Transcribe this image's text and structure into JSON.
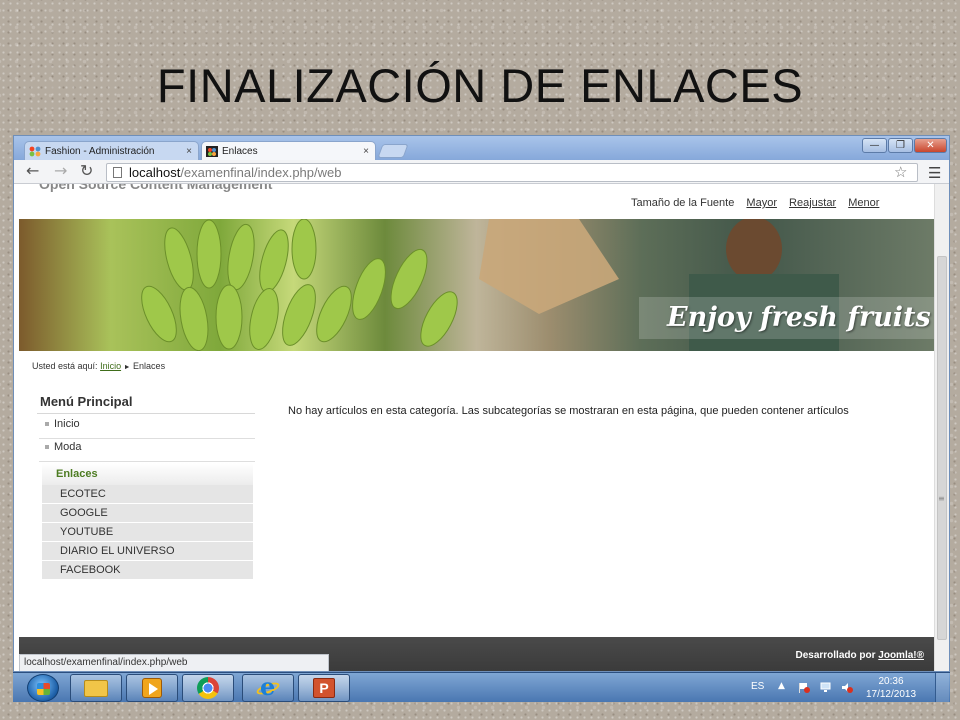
{
  "slide": {
    "title": "FINALIZACIÓN DE ENLACES"
  },
  "browser": {
    "tabs": [
      {
        "label": "Fashion - Administración",
        "close": "×"
      },
      {
        "label": "Enlaces",
        "close": "×"
      }
    ],
    "address": {
      "host": "localhost",
      "path": "/examenfinal/index.php/web"
    },
    "status_url": "localhost/examenfinal/index.php/web",
    "window_controls": {
      "minimize": "—",
      "maximize": "❐",
      "close": "✕"
    }
  },
  "site": {
    "slogan": "Open Source Content Management",
    "font_size": {
      "label": "Tamaño de la Fuente",
      "bigger": "Mayor",
      "reset": "Reajustar",
      "smaller": "Menor"
    },
    "banner_text": "Enjoy fresh fruits",
    "breadcrumb": {
      "prefix": "Usted está aquí:",
      "home": "Inicio",
      "separator": "►",
      "current": "Enlaces"
    },
    "menu": {
      "title": "Menú Principal",
      "items": [
        "Inicio",
        "Moda"
      ],
      "active": "Enlaces",
      "submenu": [
        "ECOTEC",
        "GOOGLE",
        "YOUTUBE",
        "DIARIO EL UNIVERSO",
        "FACEBOOK"
      ]
    },
    "message": "No hay artículos en esta categoría. Las subcategorías se mostraran en esta página, que pueden contener artículos",
    "footer": {
      "prefix": "Desarrollado por",
      "link": "Joomla!®"
    }
  },
  "taskbar": {
    "language": "ES",
    "clock": {
      "time": "20:36",
      "date": "17/12/2013"
    }
  },
  "colors": {
    "accent_green": "#4d7c22",
    "titlebar_blue": "#86a8da",
    "footer_dark": "#3a3a3a"
  }
}
